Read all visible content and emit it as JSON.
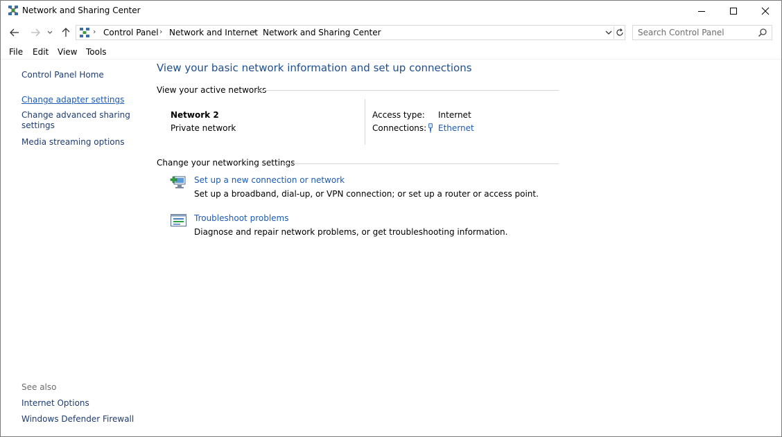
{
  "window": {
    "title": "Network and Sharing Center"
  },
  "address": {
    "crumbs": [
      "Control Panel",
      "Network and Internet",
      "Network and Sharing Center"
    ],
    "search_placeholder": "Search Control Panel"
  },
  "menu": [
    "File",
    "Edit",
    "View",
    "Tools"
  ],
  "left_pane": {
    "links": [
      "Control Panel Home",
      "Change adapter settings",
      "Change advanced sharing settings",
      "Media streaming options"
    ],
    "see_also_label": "See also",
    "see_also": [
      "Internet Options",
      "Windows Defender Firewall"
    ]
  },
  "main": {
    "title": "View your basic network information and set up connections",
    "active_networks_heading": "View your active networks",
    "network": {
      "name": "Network  2",
      "type": "Private network",
      "access_type_label": "Access type:",
      "access_type_value": "Internet",
      "connections_label": "Connections:",
      "connections_value": "Ethernet"
    },
    "settings_heading": "Change your networking settings",
    "tasks": [
      {
        "link": "Set up a new connection or network",
        "desc": "Set up a broadband, dial-up, or VPN connection; or set up a router or access point.",
        "icon": "new-connection-icon"
      },
      {
        "link": "Troubleshoot problems",
        "desc": "Diagnose and repair network problems, or get troubleshooting information.",
        "icon": "troubleshoot-icon"
      }
    ]
  },
  "colors": {
    "title_blue": "#1e4e8c",
    "link_blue": "#1a5bb4",
    "nav_link": "#1e3c6e"
  }
}
